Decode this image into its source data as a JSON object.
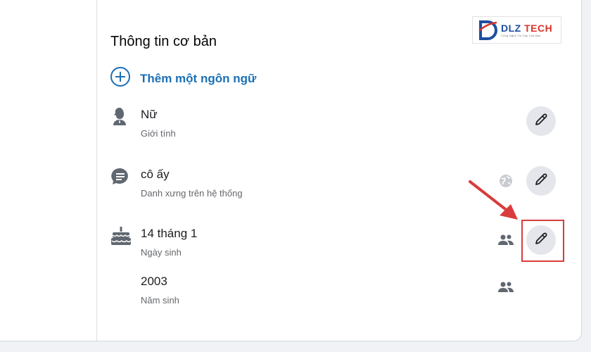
{
  "watermark": {
    "brand_dlz": "DLZ",
    "brand_tech": "TECH",
    "tagline": "Công Nghệ Tin Cậy Của Bạn"
  },
  "basic_info": {
    "title": "Thông tin cơ bản",
    "add_language": "Thêm một ngôn ngữ",
    "items": [
      {
        "value": "Nữ",
        "label": "Giới tính",
        "icon": "gender-icon",
        "audience_icon": null
      },
      {
        "value": "cô ấy",
        "label": "Danh xưng trên hệ thống",
        "icon": "chat-bubble-icon",
        "audience_icon": "globe-icon"
      },
      {
        "value": "14 tháng 1",
        "label": "Ngày sinh",
        "icon": "birthday-cake-icon",
        "audience_icon": "friends-icon"
      },
      {
        "value": "2003",
        "label": "Năm sinh",
        "icon": null,
        "audience_icon": "friends-icon"
      }
    ]
  },
  "annotation": {
    "highlight_color": "#d93c3c",
    "target": "birthday-edit-button"
  },
  "colors": {
    "accent_blue": "#1b6fb5",
    "edit_button_bg": "#e4e6eb"
  }
}
